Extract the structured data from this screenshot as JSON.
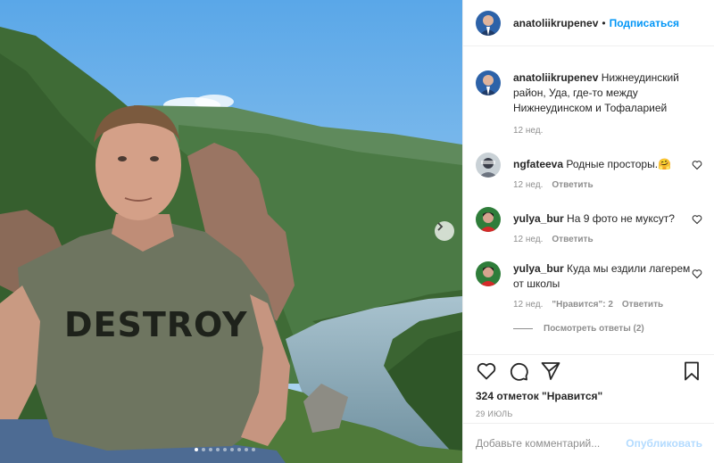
{
  "post": {
    "author": "anatoliikrupenev",
    "follow_label": "Подписаться",
    "separator": "•",
    "shirt_text": "DESTROY",
    "carousel_dots": 9,
    "active_dot": 0
  },
  "caption": {
    "username": "anatoliikrupenev",
    "text": "Нижнеудинский район, Уда, где-то между Нижнеудинском и Тофаларией",
    "time": "12 нед."
  },
  "comments": [
    {
      "username": "ngfateeva",
      "text": "Родные просторы.🤗",
      "time": "12 нед.",
      "reply_label": "Ответить",
      "likes_label": ""
    },
    {
      "username": "yulya_bur",
      "text": "На 9 фото не муксут?",
      "time": "12 нед.",
      "reply_label": "Ответить",
      "likes_label": ""
    },
    {
      "username": "yulya_bur",
      "text": "Куда мы ездили лагерем от школы",
      "time": "12 нед.",
      "reply_label": "Ответить",
      "likes_label": "\"Нравится\": 2"
    }
  ],
  "view_replies": "Посмотреть ответы (2)",
  "likes": "324 отметок \"Нравится\"",
  "date": "29 ИЮЛЬ",
  "add_comment": {
    "placeholder": "Добавьте комментарий...",
    "publish_label": "Опубликовать"
  },
  "colors": {
    "link_blue": "#0095f6",
    "publish_disabled": "#b3dbff",
    "muted": "#8e8e8e",
    "text": "#262626"
  },
  "icons": [
    "heart-icon",
    "comment-icon",
    "share-icon",
    "bookmark-icon",
    "chevron-right-icon"
  ]
}
